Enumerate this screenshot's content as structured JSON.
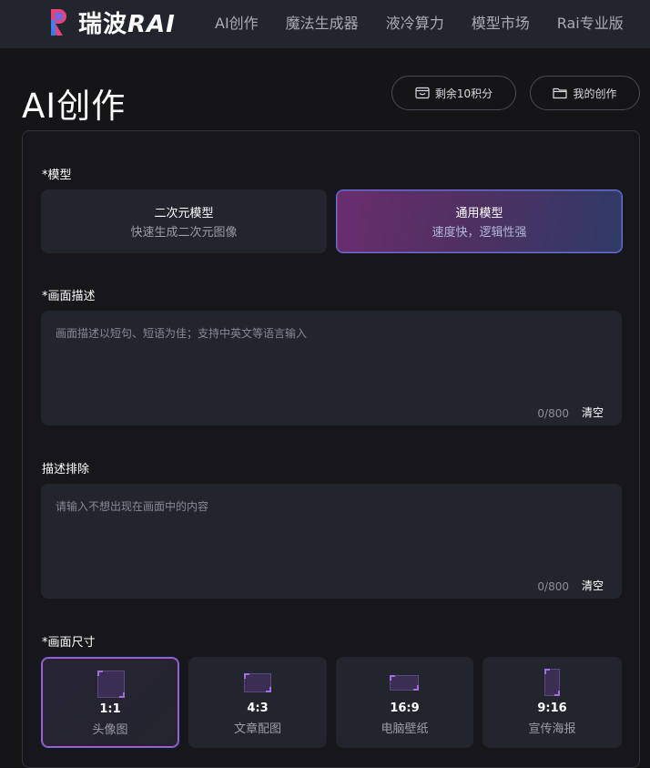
{
  "brand": {
    "name": "瑞波",
    "name_suffix": "RAI",
    "colors": {
      "pink": "#e0457e",
      "blue": "#3b7ff0",
      "accent_border": "#4d7de8",
      "accent_purple": "#b35ad6"
    }
  },
  "nav": {
    "items": [
      {
        "label": "AI创作"
      },
      {
        "label": "魔法生成器"
      },
      {
        "label": "液冷算力"
      },
      {
        "label": "模型市场"
      },
      {
        "label": "Rai专业版"
      }
    ]
  },
  "header": {
    "title": "AI创作",
    "points_label": "剩余10积分",
    "points_icon": "wallet-icon",
    "works_label": "我的创作",
    "works_icon": "folder-icon"
  },
  "form": {
    "model_label": "*模型",
    "models": [
      {
        "title": "二次元模型",
        "subtitle": "快速生成二次元图像",
        "selected": false
      },
      {
        "title": "通用模型",
        "subtitle": "速度快，逻辑性强",
        "selected": true
      }
    ],
    "prompt": {
      "label": "*画面描述",
      "placeholder": "画面描述以短句、短语为佳；支持中英文等语言输入",
      "value": "",
      "counter": "0/800",
      "clear_label": "清空"
    },
    "negative": {
      "label": "描述排除",
      "placeholder": "请输入不想出现在画面中的内容",
      "value": "",
      "counter": "0/800",
      "clear_label": "清空"
    },
    "size_label": "*画面尺寸",
    "sizes": [
      {
        "ratio": "1:1",
        "name": "头像图",
        "selected": true
      },
      {
        "ratio": "4:3",
        "name": "文章配图",
        "selected": false
      },
      {
        "ratio": "16:9",
        "name": "电脑壁纸",
        "selected": false
      },
      {
        "ratio": "9:16",
        "name": "宣传海报",
        "selected": false
      }
    ]
  }
}
